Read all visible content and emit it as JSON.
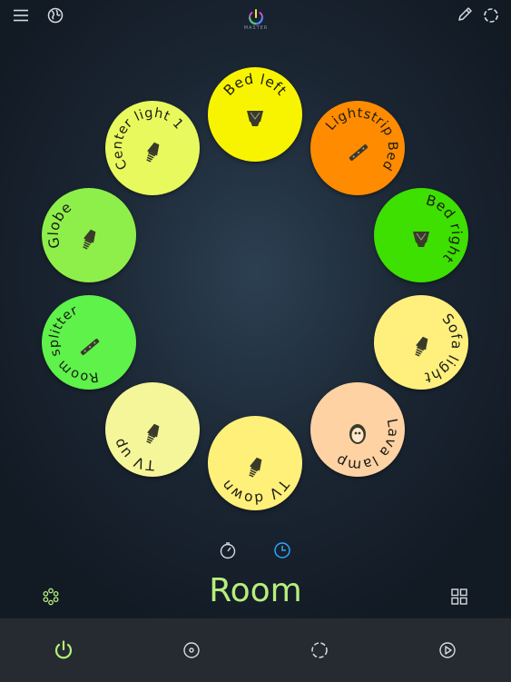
{
  "header": {
    "master_label": "MASTER",
    "icons": {
      "menu": "menu-icon",
      "globe": "globe-icon",
      "master": "power-icon",
      "edit": "pencil-icon",
      "dashed": "dashed-circle-icon"
    }
  },
  "lights": [
    {
      "name": "Bed left",
      "color": "#f8f400",
      "type": "bedside"
    },
    {
      "name": "Lightstrip Bed",
      "color": "#ff8b00",
      "type": "strip"
    },
    {
      "name": "Bed right",
      "color": "#3de000",
      "type": "bedside"
    },
    {
      "name": "Sofa light",
      "color": "#fff07e",
      "type": "spot"
    },
    {
      "name": "Lava lamp",
      "color": "#ffd2a4",
      "type": "lava"
    },
    {
      "name": "TV down",
      "color": "#fff07a",
      "type": "spot"
    },
    {
      "name": "TV up",
      "color": "#f5f69a",
      "type": "spot"
    },
    {
      "name": "Room splitter",
      "color": "#5ef24b",
      "type": "strip"
    },
    {
      "name": "Globe",
      "color": "#8eef4a",
      "type": "spot"
    },
    {
      "name": "Center light 1",
      "color": "#e8f95e",
      "type": "spot"
    }
  ],
  "timers": {
    "left_icon": "timer-icon",
    "right_icon": "clock-icon",
    "active_color": "#2aa7ff"
  },
  "room": {
    "title": "Room",
    "title_color": "#b6ee7c"
  },
  "bottom_nav": [
    {
      "icon": "power-icon",
      "active": true
    },
    {
      "icon": "scene-icon",
      "active": false
    },
    {
      "icon": "dashed-circle-icon",
      "active": false
    },
    {
      "icon": "play-icon",
      "active": false
    }
  ],
  "side_buttons": {
    "left": "group-icon",
    "right": "grid-icon"
  }
}
